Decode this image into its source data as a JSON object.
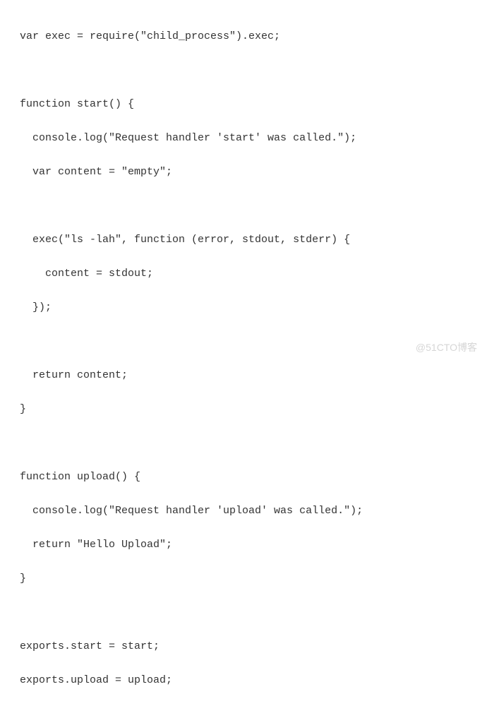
{
  "code": {
    "line1": "var exec = require(\"child_process\").exec;",
    "line2": "",
    "line3": "function start() {",
    "line4": "  console.log(\"Request handler 'start' was called.\");",
    "line5": "  var content = \"empty\";",
    "line6": "",
    "line7": "  exec(\"ls -lah\", function (error, stdout, stderr) {",
    "line8": "    content = stdout;",
    "line9": "  });",
    "line10": "",
    "line11": "  return content;",
    "line12": "}",
    "line13": "",
    "line14": "function upload() {",
    "line15": "  console.log(\"Request handler 'upload' was called.\");",
    "line16": "  return \"Hello Upload\";",
    "line17": "}",
    "line18": "",
    "line19": "exports.start = start;",
    "line20": "exports.upload = upload;"
  },
  "watermark": "@51CTO博客"
}
